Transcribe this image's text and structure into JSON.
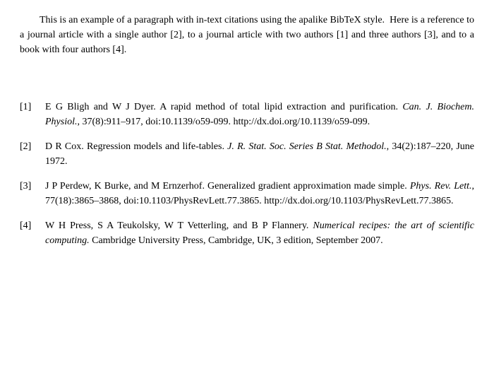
{
  "paragraph": {
    "text_parts": [
      "This is an example of a paragraph with in-text citations using the apalike BibTeX style.  Here is a reference to a journal article with a single author [2], to a journal article with two authors [1] and three authors [3], and to a book with four authors [4]."
    ]
  },
  "references": {
    "items": [
      {
        "label": "[1]",
        "content_html": "E G Bligh and W J Dyer.  A rapid method of total lipid extraction and purification.  <em>Can. J. Biochem. Physiol.</em>, 37(8):911–917, doi:10.1139/o59-099.  http://dx.doi.org/10.1139/o59-099."
      },
      {
        "label": "[2]",
        "content_html": "D R Cox.  Regression models and life-tables.  <em>J. R. Stat. Soc. Series B Stat. Methodol.</em>, 34(2):187–220, June 1972."
      },
      {
        "label": "[3]",
        "content_html": "J P Perdew, K Burke, and M Ernzerhof.  Generalized gradient approximation made simple.  <em>Phys. Rev. Lett.</em>, 77(18):3865–3868, doi:10.1103/PhysRevLett.77.3865. http://dx.doi.org/10.1103/PhysRevLett.77.3865."
      },
      {
        "label": "[4]",
        "content_html": "W H Press, S A Teukolsky, W T Vetterling, and B P Flannery.  <em>Numerical recipes: the art of scientific computing.</em>  Cambridge University Press, Cambridge, UK, 3 edition, September 2007."
      }
    ]
  }
}
